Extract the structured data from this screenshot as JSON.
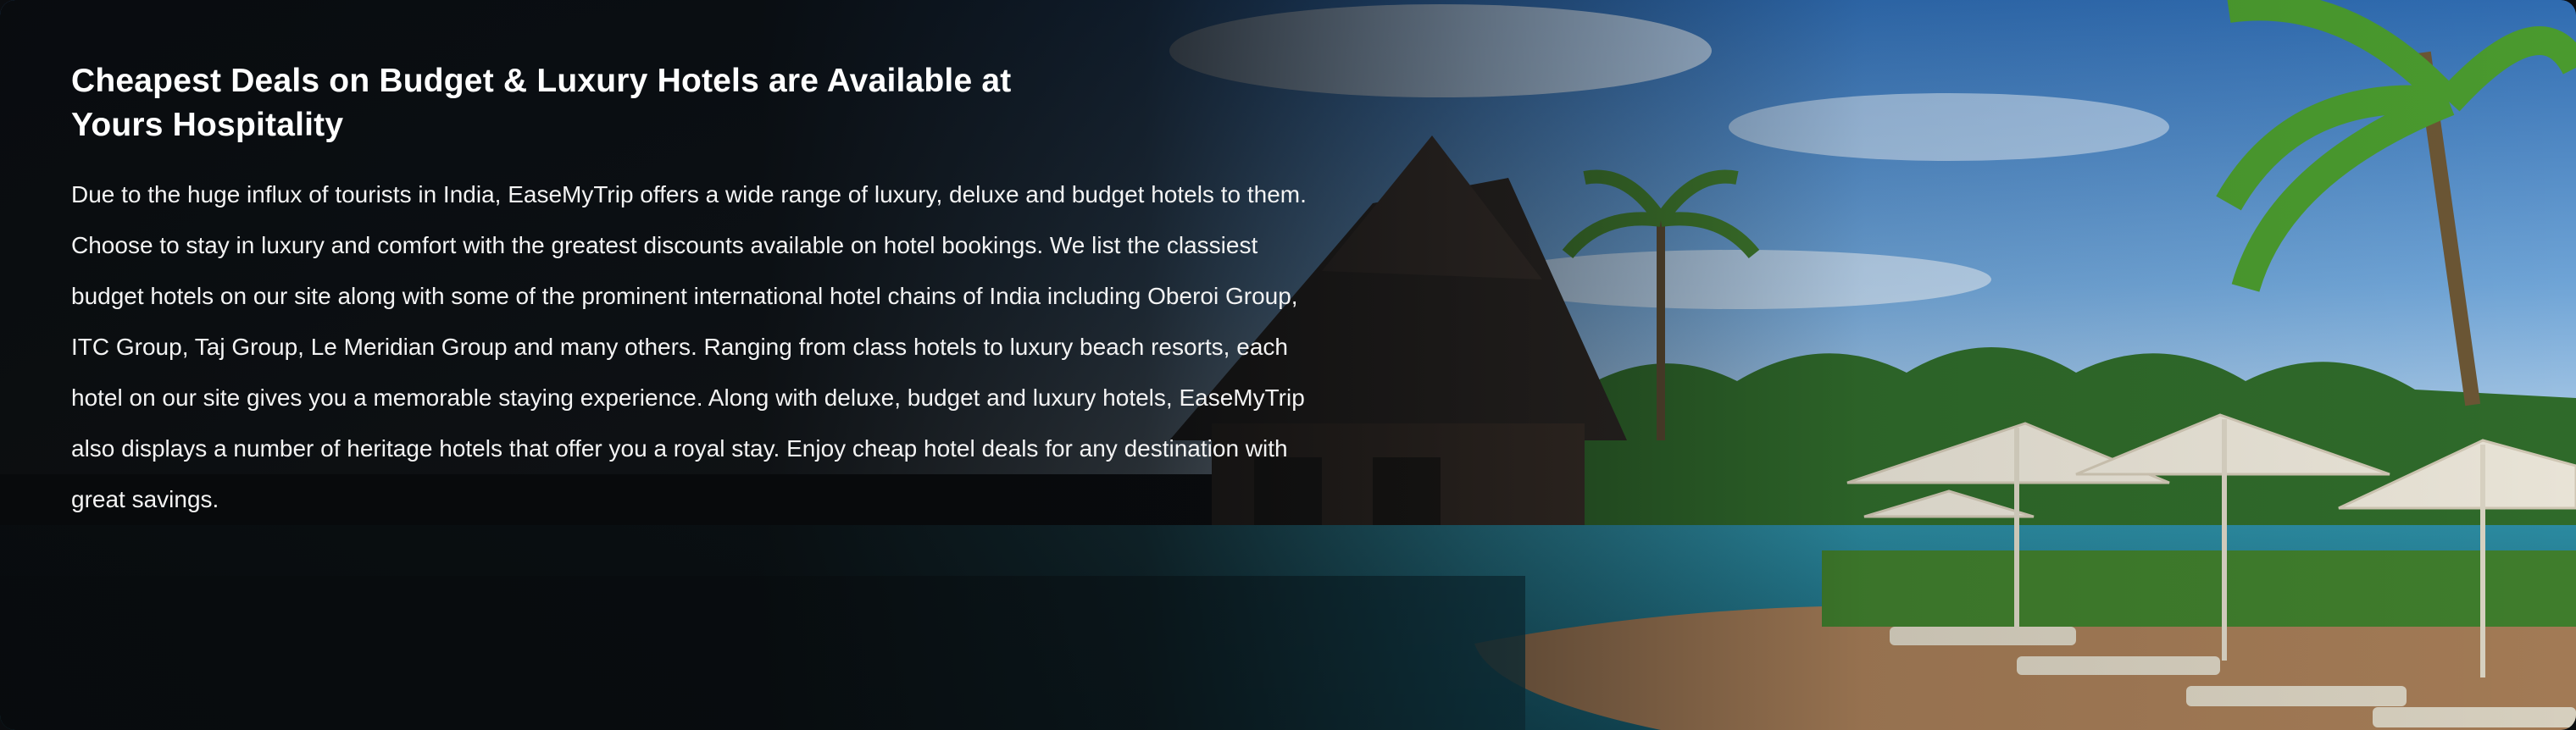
{
  "banner": {
    "title": "Cheapest Deals on Budget & Luxury Hotels are Available at Yours Hospitality",
    "description": "Due to the huge influx of tourists in India, EaseMyTrip offers a wide range of luxury, deluxe and budget hotels to them. Choose to stay in luxury and comfort with the greatest discounts available on hotel bookings. We list the classiest budget hotels on our site along with some of the prominent international hotel chains of India including Oberoi Group, ITC Group, Taj Group, Le Meridian Group and many others. Ranging from class hotels to luxury beach resorts, each hotel on our site gives you a memorable staying experience. Along with deluxe, budget and luxury hotels, EaseMyTrip also displays a number of heritage hotels that offer you a royal stay. Enjoy cheap hotel deals for any destination with great savings."
  },
  "colors": {
    "text": "#ffffff",
    "overlay": "#080a0c",
    "sky": "#3f7fc4",
    "water": "#1e6f86",
    "palm": "#3e8a2a",
    "umbrella": "#e8e3d6"
  },
  "background_image": "resort-pool-with-beach-umbrellas-and-palm-trees"
}
